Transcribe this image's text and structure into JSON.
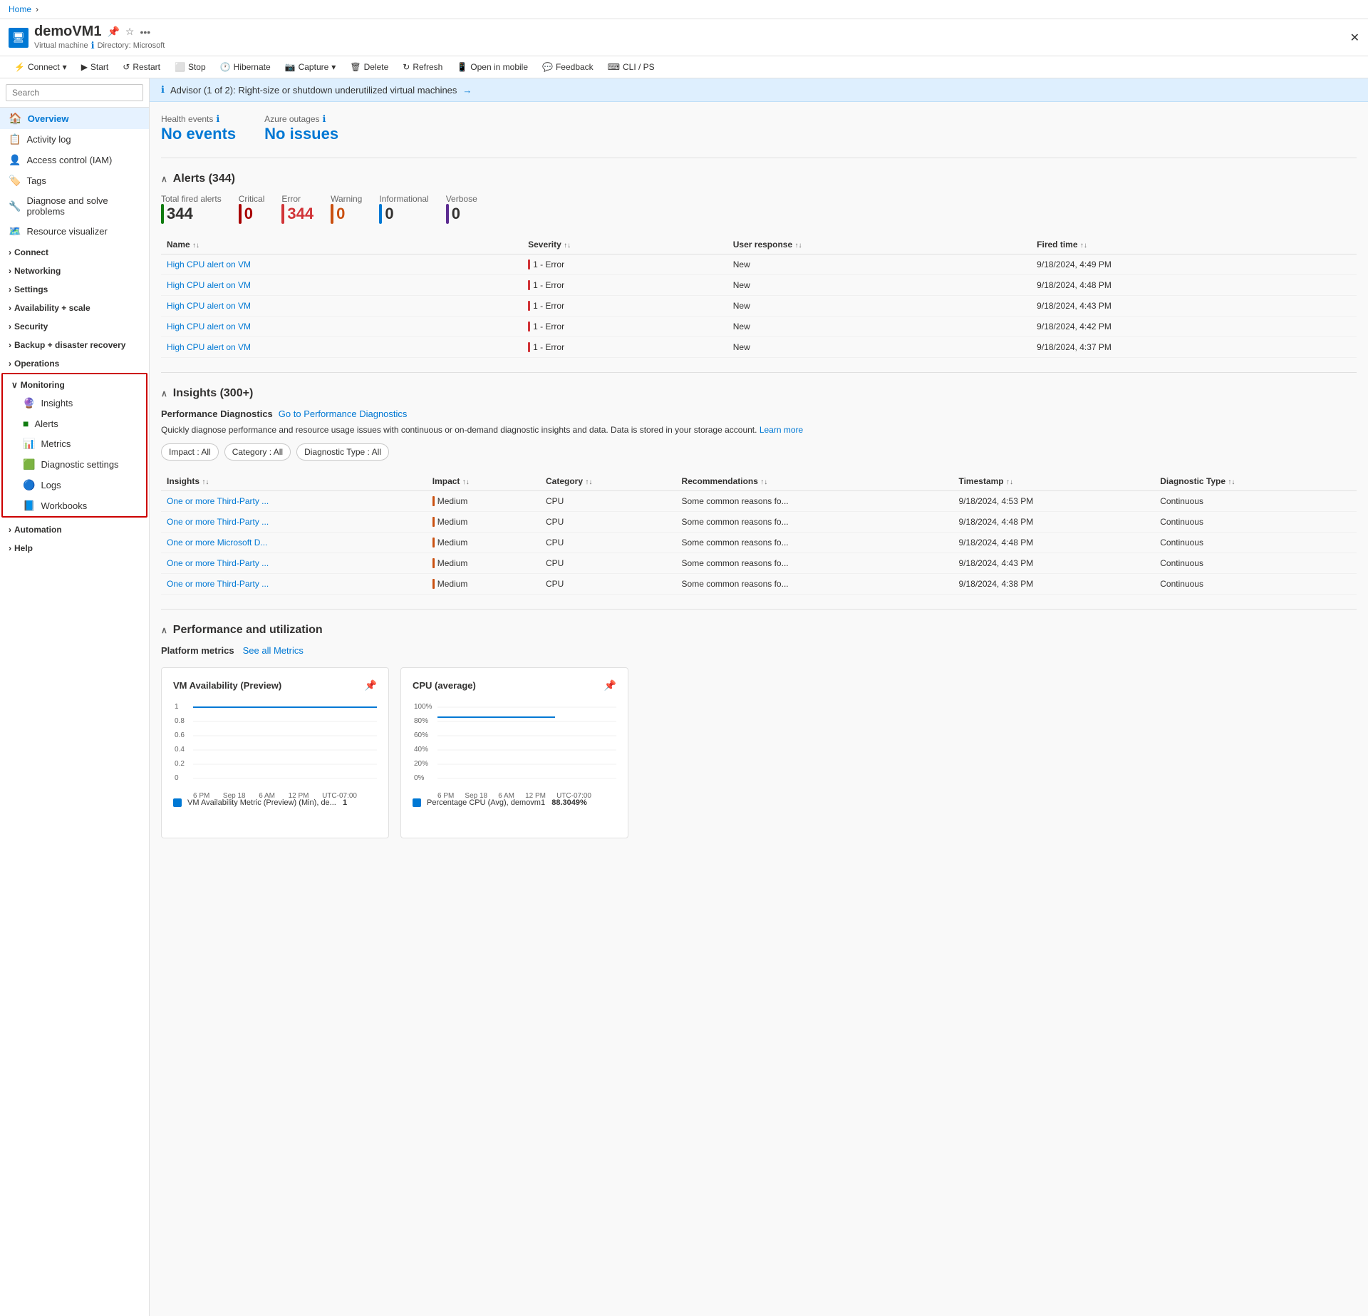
{
  "breadcrumb": {
    "home": "Home"
  },
  "vm": {
    "name": "demoVM1",
    "type": "Virtual machine",
    "directory": "Directory: Microsoft",
    "icon": "💻"
  },
  "toolbar": {
    "connect": "Connect",
    "start": "Start",
    "restart": "Restart",
    "stop": "Stop",
    "hibernate": "Hibernate",
    "capture": "Capture",
    "delete": "Delete",
    "refresh": "Refresh",
    "open_in_mobile": "Open in mobile",
    "feedback": "Feedback",
    "cli_ps": "CLI / PS"
  },
  "sidebar": {
    "search_placeholder": "Search",
    "items": [
      {
        "id": "overview",
        "label": "Overview",
        "icon": "🏠",
        "active": true
      },
      {
        "id": "activity-log",
        "label": "Activity log",
        "icon": "📋"
      },
      {
        "id": "access-control",
        "label": "Access control (IAM)",
        "icon": "👤"
      },
      {
        "id": "tags",
        "label": "Tags",
        "icon": "🏷️"
      },
      {
        "id": "diagnose",
        "label": "Diagnose and solve problems",
        "icon": "🔧"
      },
      {
        "id": "resource-visualizer",
        "label": "Resource visualizer",
        "icon": "🗺️"
      }
    ],
    "groups": [
      {
        "id": "connect",
        "label": "Connect",
        "expanded": false
      },
      {
        "id": "networking",
        "label": "Networking",
        "expanded": false
      },
      {
        "id": "settings",
        "label": "Settings",
        "expanded": false
      },
      {
        "id": "availability-scale",
        "label": "Availability + scale",
        "expanded": false
      },
      {
        "id": "security",
        "label": "Security",
        "expanded": false
      },
      {
        "id": "backup-disaster-recovery",
        "label": "Backup + disaster recovery",
        "expanded": false
      },
      {
        "id": "operations",
        "label": "Operations",
        "expanded": false
      }
    ],
    "monitoring": {
      "label": "Monitoring",
      "expanded": true,
      "items": [
        {
          "id": "insights",
          "label": "Insights",
          "icon": "🔮"
        },
        {
          "id": "alerts",
          "label": "Alerts",
          "icon": "🟢"
        },
        {
          "id": "metrics",
          "label": "Metrics",
          "icon": "📊"
        },
        {
          "id": "diagnostic-settings",
          "label": "Diagnostic settings",
          "icon": "🟩"
        },
        {
          "id": "logs",
          "label": "Logs",
          "icon": "🔵"
        },
        {
          "id": "workbooks",
          "label": "Workbooks",
          "icon": "📘"
        }
      ]
    },
    "bottom_groups": [
      {
        "id": "automation",
        "label": "Automation",
        "expanded": false
      },
      {
        "id": "help",
        "label": "Help",
        "expanded": false
      }
    ]
  },
  "advisor": {
    "text": "Advisor (1 of 2): Right-size or shutdown underutilized virtual machines",
    "arrow": "→"
  },
  "health": {
    "events_label": "Health events",
    "events_value": "No events",
    "outages_label": "Azure outages",
    "outages_value": "No issues"
  },
  "alerts_section": {
    "title": "Alerts (344)",
    "total_label": "Total fired alerts",
    "total_value": "344",
    "critical_label": "Critical",
    "critical_value": "0",
    "error_label": "Error",
    "error_value": "344",
    "warning_label": "Warning",
    "warning_value": "0",
    "informational_label": "Informational",
    "informational_value": "0",
    "verbose_label": "Verbose",
    "verbose_value": "0",
    "columns": [
      "Name",
      "Severity",
      "User response",
      "Fired time"
    ],
    "rows": [
      {
        "name": "High CPU alert on VM",
        "severity": "1 - Error",
        "user_response": "New",
        "fired_time": "9/18/2024, 4:49 PM"
      },
      {
        "name": "High CPU alert on VM",
        "severity": "1 - Error",
        "user_response": "New",
        "fired_time": "9/18/2024, 4:48 PM"
      },
      {
        "name": "High CPU alert on VM",
        "severity": "1 - Error",
        "user_response": "New",
        "fired_time": "9/18/2024, 4:43 PM"
      },
      {
        "name": "High CPU alert on VM",
        "severity": "1 - Error",
        "user_response": "New",
        "fired_time": "9/18/2024, 4:42 PM"
      },
      {
        "name": "High CPU alert on VM",
        "severity": "1 - Error",
        "user_response": "New",
        "fired_time": "9/18/2024, 4:37 PM"
      }
    ]
  },
  "insights_section": {
    "title": "Insights (300+)",
    "perf_diag_label": "Performance Diagnostics",
    "perf_diag_link": "Go to Performance Diagnostics",
    "perf_diag_desc": "Quickly diagnose performance and resource usage issues with continuous or on-demand diagnostic insights and data. Data is stored in your storage account.",
    "learn_more": "Learn more",
    "filters": [
      {
        "label": "Impact : All"
      },
      {
        "label": "Category : All"
      },
      {
        "label": "Diagnostic Type : All"
      }
    ],
    "columns": [
      "Insights",
      "Impact",
      "Category",
      "Recommendations",
      "Timestamp",
      "Diagnostic Type"
    ],
    "rows": [
      {
        "insight": "One or more Third-Party ...",
        "impact": "Medium",
        "category": "CPU",
        "recommendations": "Some common reasons fo...",
        "timestamp": "9/18/2024, 4:53 PM",
        "diag_type": "Continuous"
      },
      {
        "insight": "One or more Third-Party ...",
        "impact": "Medium",
        "category": "CPU",
        "recommendations": "Some common reasons fo...",
        "timestamp": "9/18/2024, 4:48 PM",
        "diag_type": "Continuous"
      },
      {
        "insight": "One or more Microsoft D...",
        "impact": "Medium",
        "category": "CPU",
        "recommendations": "Some common reasons fo...",
        "timestamp": "9/18/2024, 4:48 PM",
        "diag_type": "Continuous"
      },
      {
        "insight": "One or more Third-Party ...",
        "impact": "Medium",
        "category": "CPU",
        "recommendations": "Some common reasons fo...",
        "timestamp": "9/18/2024, 4:43 PM",
        "diag_type": "Continuous"
      },
      {
        "insight": "One or more Third-Party ...",
        "impact": "Medium",
        "category": "CPU",
        "recommendations": "Some common reasons fo...",
        "timestamp": "9/18/2024, 4:38 PM",
        "diag_type": "Continuous"
      }
    ]
  },
  "performance_section": {
    "title": "Performance and utilization",
    "platform_metrics_label": "Platform metrics",
    "see_all_link": "See all Metrics",
    "charts": [
      {
        "id": "vm-availability",
        "title": "VM Availability (Preview)",
        "legend_text": "VM Availability Metric (Preview) (Min), de...",
        "legend_value": "1",
        "y_labels": [
          "1",
          "0.8",
          "0.6",
          "0.4",
          "0.2",
          "0"
        ],
        "x_labels": [
          "6 PM",
          "Sep 18",
          "6 AM",
          "12 PM",
          "UTC-07:00"
        ],
        "line_color": "#0078d4",
        "line_y_percent": 20
      },
      {
        "id": "cpu-average",
        "title": "CPU (average)",
        "legend_text": "Percentage CPU (Avg), demovm1",
        "legend_value": "88.3049%",
        "y_labels": [
          "100%",
          "80%",
          "60%",
          "40%",
          "20%",
          "0%"
        ],
        "x_labels": [
          "6 PM",
          "Sep 18",
          "6 AM",
          "12 PM",
          "UTC-07:00"
        ],
        "line_color": "#0078d4",
        "line_y_percent": 22
      }
    ]
  }
}
